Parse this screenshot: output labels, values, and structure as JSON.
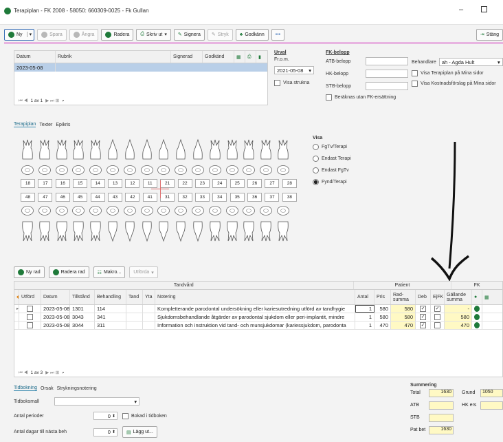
{
  "window": {
    "title": "Terapiplan - FK 2008 - 58050: 660309-0025 - Fk Gullan"
  },
  "toolbar": {
    "new": "Ny",
    "save": "Spara",
    "undo": "Ångra",
    "delete": "Radera",
    "print": "Skriv ut",
    "sign": "Signera",
    "strike": "Stryk",
    "approve": "Godkänn",
    "more": "•••",
    "close": "Stäng"
  },
  "plans": {
    "columns": {
      "date": "Datum",
      "title": "Rubrik",
      "signed": "Signerad",
      "approved": "Godkänd"
    },
    "rows": [
      {
        "date": "2023-05-08",
        "title": ""
      }
    ],
    "pager": "1 av 1"
  },
  "filter": {
    "section": "Urval",
    "from_label": "Fr.o.m.",
    "from_value": "2021-05-08",
    "show_struck": "Visa strukna"
  },
  "fk_amount": {
    "section": "FK-belopp",
    "atb": "ATB-belopp",
    "hk": "HK-belopp",
    "stb": "STB-belopp",
    "no_fk": "Beräknas utan FK-ersättning"
  },
  "practitioner": {
    "label": "Behandlare",
    "value": "ah - Agda Hult",
    "show_plan": "Visa Terapiplan på Mina sidor",
    "show_cost": "Visa Kostnadsförslag på Mina sidor"
  },
  "tabs": {
    "t1": "Terapiplan",
    "t2": "Texter",
    "t3": "Epikris"
  },
  "teeth": {
    "upper": [
      "18",
      "17",
      "16",
      "15",
      "14",
      "13",
      "12",
      "11",
      "21",
      "22",
      "23",
      "24",
      "25",
      "26",
      "27",
      "28"
    ],
    "lower": [
      "48",
      "47",
      "46",
      "45",
      "44",
      "43",
      "42",
      "41",
      "31",
      "32",
      "33",
      "34",
      "35",
      "36",
      "37",
      "38"
    ]
  },
  "view": {
    "label": "Visa",
    "o1": "FgTv/Terapi",
    "o2": "Endast Terapi",
    "o3": "Endast FgTv",
    "o4": "Fynd/Terapi",
    "selected": "Fynd/Terapi"
  },
  "rows_toolbar": {
    "new_row": "Ny rad",
    "delete_row": "Radera rad",
    "macro": "Makro...",
    "done": "Utförda"
  },
  "treatments": {
    "group_dental": "Tandvård",
    "group_patient": "Patient",
    "group_fk": "FK",
    "columns": {
      "done": "Utförd",
      "date": "Datum",
      "status": "Tillstånd",
      "treatment": "Behandling",
      "tooth": "Tand",
      "surface": "Yta",
      "note": "Notering",
      "count": "Antal",
      "price": "Pris",
      "rowsum": "Rad-summa",
      "deb": "Deb",
      "ejfk": "EjFK",
      "current": "Gällande summa"
    },
    "rows": [
      {
        "date": "2023-05-08",
        "status": "1301",
        "treatment": "114",
        "note": "Kompletterande parodontal undersökning eller kariesutredning utförd av tandhygie",
        "count": "1",
        "price": "580",
        "rowsum": "580",
        "current": "-"
      },
      {
        "date": "2023-05-08",
        "status": "3043",
        "treatment": "341",
        "note": "Sjukdomsbehandlande åtgärder av parodontal sjukdom eller peri-implantit, mindre",
        "count": "1",
        "price": "580",
        "rowsum": "580",
        "current": "580"
      },
      {
        "date": "2023-05-08",
        "status": "3044",
        "treatment": "311",
        "note": "Information och instruktion vid tand- och munsjukdomar (kariessjukdom, parodonta",
        "count": "1",
        "price": "470",
        "rowsum": "470",
        "current": "470"
      }
    ],
    "pager": "1 av 3"
  },
  "booking": {
    "tabs": {
      "t1": "Tidbokning",
      "t2": "Orsak",
      "t3": "Strykningsnotering"
    },
    "template": "Tidboksmall",
    "periods": "Antal perioder",
    "periods_value": "0",
    "booked": "Bokad i tidboken",
    "days": "Antal dagar till nästa beh",
    "days_value": "0",
    "add": "Lägg ut..."
  },
  "summary": {
    "title": "Summering",
    "total": "Total",
    "total_value": "1630",
    "basis": "Grund",
    "basis_value": "1050",
    "atb": "ATB",
    "hk": "HK ers",
    "stb": "STB",
    "patient": "Pat bet",
    "patient_value": "1630"
  }
}
